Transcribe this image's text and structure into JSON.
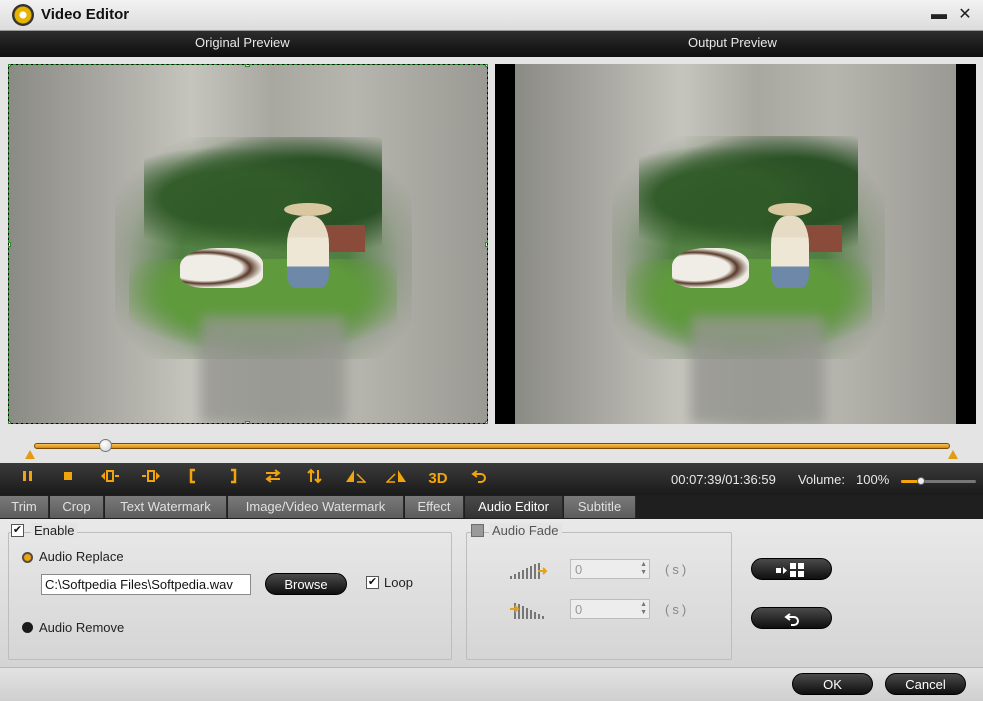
{
  "window": {
    "title": "Video Editor",
    "minimize_glyph": "▬",
    "close_glyph": "✕"
  },
  "preview": {
    "original_label": "Original Preview",
    "output_label": "Output Preview"
  },
  "timeline": {
    "position_fraction": 0.078
  },
  "toolbar": {
    "icons": [
      "pause-icon",
      "stop-icon",
      "previous-frame-icon",
      "next-frame-icon",
      "set-start-icon",
      "set-end-icon",
      "flip-horizontal-icon",
      "flip-vertical-icon",
      "rotate-left-icon",
      "rotate-right-icon",
      "3d-icon",
      "undo-icon"
    ],
    "threed_label": "3D",
    "time": "00:07:39/01:36:59",
    "volume_label": "Volume:",
    "volume_value": "100%",
    "volume_fraction": 0.26,
    "accent_color": "#f2a40c"
  },
  "tabs": [
    {
      "label": "Trim"
    },
    {
      "label": "Crop"
    },
    {
      "label": "Text Watermark"
    },
    {
      "label": "Image/Video Watermark"
    },
    {
      "label": "Effect"
    },
    {
      "label": "Audio Editor"
    },
    {
      "label": "Subtitle"
    }
  ],
  "active_tab": "Audio Editor",
  "audio": {
    "enable_label": "Enable",
    "replace_label": "Audio Replace",
    "file_path": "C:\\Softpedia Files\\Softpedia.wav",
    "browse_label": "Browse",
    "loop_label": "Loop",
    "remove_label": "Audio Remove",
    "fade_label": "Audio Fade",
    "fade_in_value": "0",
    "fade_out_value": "0",
    "unit": "(s)"
  },
  "footer": {
    "ok_label": "OK",
    "cancel_label": "Cancel"
  }
}
